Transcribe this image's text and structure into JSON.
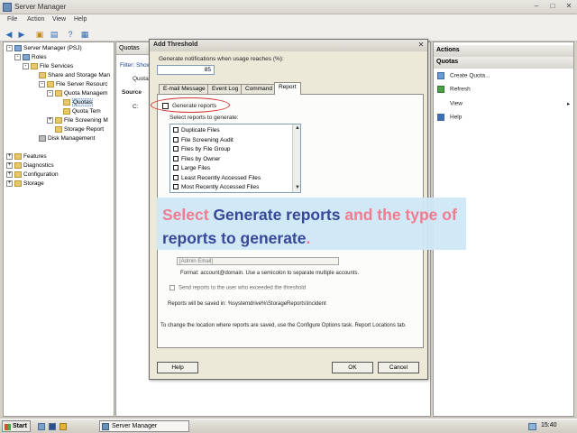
{
  "window": {
    "title": "Server Manager"
  },
  "menu": [
    "File",
    "Action",
    "View",
    "Help"
  ],
  "tree": [
    {
      "label": "Server Manager (PSJ)",
      "indent": 0,
      "exp": "-",
      "icon": "blue"
    },
    {
      "label": "Roles",
      "indent": 1,
      "exp": "-",
      "icon": "blue"
    },
    {
      "label": "File Services",
      "indent": 2,
      "exp": "-",
      "icon": "yellow"
    },
    {
      "label": "Share and Storage Man",
      "indent": 3,
      "exp": "",
      "icon": "yellow"
    },
    {
      "label": "File Server Resourc",
      "indent": 4,
      "exp": "-",
      "icon": "yellow"
    },
    {
      "label": "Quota Managem",
      "indent": 5,
      "exp": "-",
      "icon": "yellow"
    },
    {
      "label": "Quotas",
      "indent": 6,
      "exp": "",
      "icon": "yellow",
      "selected": true
    },
    {
      "label": "Quota Tem",
      "indent": 6,
      "exp": "",
      "icon": "yellow"
    },
    {
      "label": "File Screening M",
      "indent": 5,
      "exp": "+",
      "icon": "yellow"
    },
    {
      "label": "Storage Report",
      "indent": 5,
      "exp": "",
      "icon": "yellow"
    },
    {
      "label": "Disk Management",
      "indent": 3,
      "exp": "",
      "icon": "gray"
    },
    {
      "label": "Features",
      "indent": 0,
      "exp": "+",
      "icon": "yellow"
    },
    {
      "label": "Diagnostics",
      "indent": 0,
      "exp": "+",
      "icon": "yellow"
    },
    {
      "label": "Configuration",
      "indent": 0,
      "exp": "+",
      "icon": "yellow"
    },
    {
      "label": "Storage",
      "indent": 0,
      "exp": "+",
      "icon": "yellow"
    }
  ],
  "midpanel": {
    "header": "Quotas",
    "filter": "Filter: Show",
    "col": "Quota",
    "group": "Source",
    "row": "C:"
  },
  "actions": {
    "header": "Actions",
    "section": "Quotas",
    "items": [
      "Create Quota...",
      "Refresh",
      "View",
      "Help"
    ]
  },
  "dialog": {
    "title": "Add Threshold",
    "prompt": "Generate notifications when usage reaches (%):",
    "threshold_value": "85",
    "tabs": [
      "E-mail Message",
      "Event Log",
      "Command",
      "Report"
    ],
    "generate_reports_label": "Generate reports",
    "select_reports_label": "Select reports to generate:",
    "reports": [
      "Duplicate Files",
      "File Screening Audit",
      "Files by File Group",
      "Files by Owner",
      "Large Files",
      "Least Recently Accessed Files",
      "Most Recently Accessed Files"
    ],
    "admin_field": "[Admin Email]",
    "format_note": "Format: account@domain. Use a semicolon to separate multiple accounts.",
    "send_to_user_label": "Send reports to the user who exceeded the threshold",
    "saved_note": "Reports will be saved in: %systemdrive%\\StorageReports\\Incident",
    "location_note": "To change the location where reports are saved, use the Configure Options task. Report Locations tab.",
    "help_button": "Help",
    "ok_button": "OK",
    "cancel_button": "Cancel"
  },
  "callout": {
    "parts": [
      {
        "text": "Select ",
        "color": "pink"
      },
      {
        "text": "Generate reports",
        "color": "blue"
      },
      {
        "text": " and the ",
        "color": "pink"
      },
      {
        "text": "type of ",
        "color": "pink"
      },
      {
        "text": "reports to generate",
        "color": "blue"
      },
      {
        "text": ".",
        "color": "pink"
      }
    ]
  },
  "taskbar": {
    "start": "Start",
    "task": "Server Manager",
    "clock": "15:40"
  },
  "colors": {
    "callout_bg": "#cfe8f7",
    "callout_pink": "#f2768a",
    "callout_blue": "#2f3e93",
    "highlight": "#d43434"
  }
}
